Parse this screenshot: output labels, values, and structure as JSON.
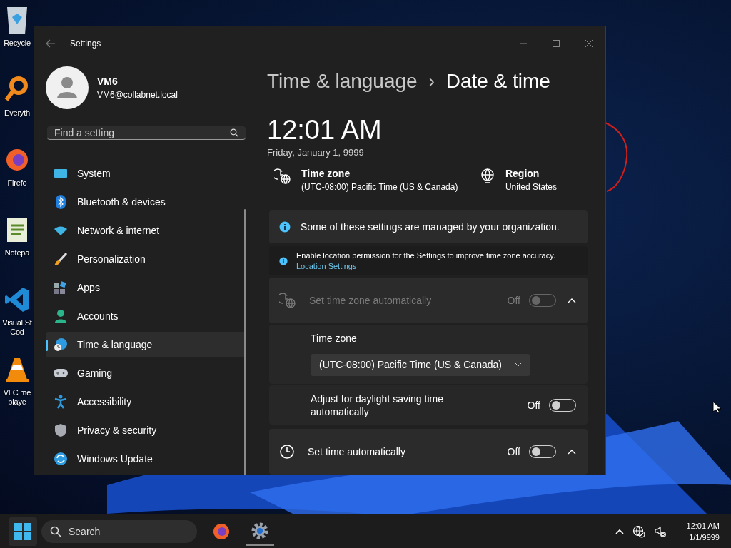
{
  "desktop_icons": [
    {
      "label": [
        "Recycle"
      ]
    },
    {
      "label": [
        "Everyth"
      ]
    },
    {
      "label": [
        "Firefo"
      ]
    },
    {
      "label": [
        "Notepa"
      ]
    },
    {
      "label": [
        "Visual St",
        "Cod"
      ]
    },
    {
      "label": [
        "VLC me",
        "playe"
      ]
    }
  ],
  "window": {
    "title": "Settings"
  },
  "account": {
    "name": "VM6",
    "email": "VM6@collabnet.local"
  },
  "search": {
    "placeholder": "Find a setting"
  },
  "nav": [
    {
      "label": "System",
      "selected": false
    },
    {
      "label": "Bluetooth & devices",
      "selected": false
    },
    {
      "label": "Network & internet",
      "selected": false
    },
    {
      "label": "Personalization",
      "selected": false
    },
    {
      "label": "Apps",
      "selected": false
    },
    {
      "label": "Accounts",
      "selected": false
    },
    {
      "label": "Time & language",
      "selected": true
    },
    {
      "label": "Gaming",
      "selected": false
    },
    {
      "label": "Accessibility",
      "selected": false
    },
    {
      "label": "Privacy & security",
      "selected": false
    },
    {
      "label": "Windows Update",
      "selected": false
    }
  ],
  "breadcrumb": {
    "parent": "Time & language",
    "separator": "›",
    "current": "Date & time"
  },
  "clock": {
    "time": "12:01 AM",
    "date": "Friday, January 1, 9999"
  },
  "summary": [
    {
      "label": "Time zone",
      "value": "(UTC-08:00) Pacific Time (US & Canada)"
    },
    {
      "label": "Region",
      "value": "United States"
    }
  ],
  "notice": {
    "text": "Some of these settings are managed by your organization."
  },
  "location_notice": {
    "text": "Enable location permission for the Settings to improve time zone accuracy.",
    "link": "Location Settings"
  },
  "settings": [
    {
      "kind": "expander",
      "label": "Set time zone automatically",
      "disabled": true,
      "state": "Off",
      "on": false,
      "expanded": true
    },
    {
      "kind": "dropdown",
      "label": "Time zone",
      "value": "(UTC-08:00) Pacific Time (US & Canada)"
    },
    {
      "kind": "toggle",
      "label": "Adjust for daylight saving time automatically",
      "state": "Off",
      "on": false
    },
    {
      "kind": "expander",
      "label": "Set time automatically",
      "state": "Off",
      "on": false,
      "expanded": true
    }
  ],
  "taskbar": {
    "search_placeholder": "Search",
    "time": "12:01 AM",
    "date": "1/1/9999"
  }
}
